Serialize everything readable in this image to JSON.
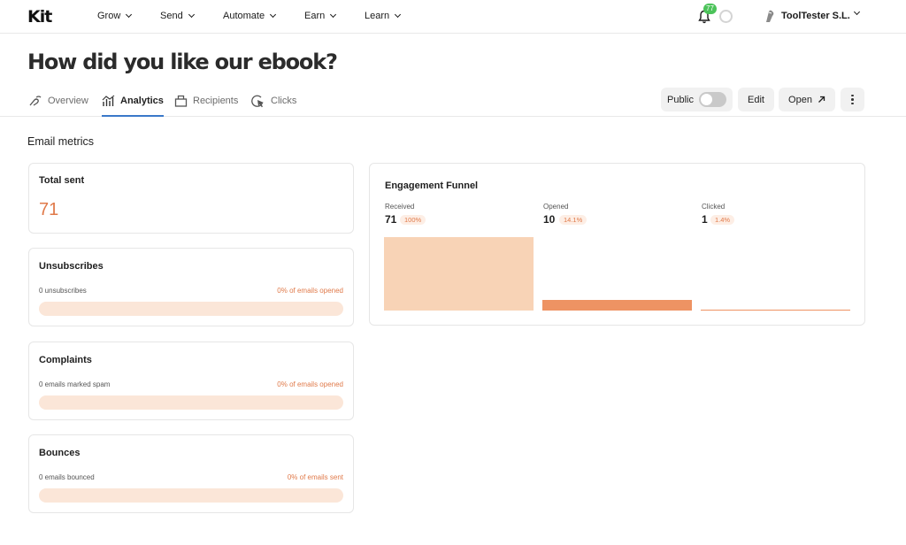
{
  "brand": {
    "logo": "Kit"
  },
  "nav": {
    "items": [
      {
        "label": "Grow"
      },
      {
        "label": "Send"
      },
      {
        "label": "Automate"
      },
      {
        "label": "Earn"
      },
      {
        "label": "Learn"
      }
    ],
    "notifications_count": "77",
    "account_name": "ToolTester S.L."
  },
  "page": {
    "title": "How did you like our ebook?"
  },
  "tabs": [
    {
      "label": "Overview",
      "icon": "overview-icon"
    },
    {
      "label": "Analytics",
      "icon": "analytics-icon",
      "active": true
    },
    {
      "label": "Recipients",
      "icon": "recipients-icon"
    },
    {
      "label": "Clicks",
      "icon": "clicks-icon"
    }
  ],
  "actions": {
    "public_label": "Public",
    "public_enabled": false,
    "edit_label": "Edit",
    "open_label": "Open"
  },
  "metrics": {
    "section_title": "Email metrics",
    "total_sent": {
      "title": "Total sent",
      "value": "71"
    },
    "unsubscribes": {
      "title": "Unsubscribes",
      "left": "0 unsubscribes",
      "right": "0% of emails opened",
      "fraction": 0
    },
    "complaints": {
      "title": "Complaints",
      "left": "0 emails marked spam",
      "right": "0% of emails opened",
      "fraction": 0
    },
    "bounces": {
      "title": "Bounces",
      "left": "0 emails bounced",
      "right": "0% of emails sent",
      "fraction": 0
    }
  },
  "funnel": {
    "title": "Engagement Funnel",
    "stages": [
      {
        "label": "Received",
        "value": "71",
        "pct": "100%"
      },
      {
        "label": "Opened",
        "value": "10",
        "pct": "14.1%"
      },
      {
        "label": "Clicked",
        "value": "1",
        "pct": "1.4%"
      }
    ]
  },
  "chart_data": {
    "type": "bar",
    "title": "Engagement Funnel",
    "categories": [
      "Received",
      "Opened",
      "Clicked"
    ],
    "values": [
      71,
      10,
      1
    ],
    "percentages": [
      100,
      14.1,
      1.4
    ],
    "colors": [
      "#f8d3b6",
      "#ee9363",
      "#ee9363"
    ]
  },
  "colors": {
    "accent": "#e07a4a",
    "tab_underline": "#3a78c9",
    "bar_track": "#fbe6d8"
  }
}
